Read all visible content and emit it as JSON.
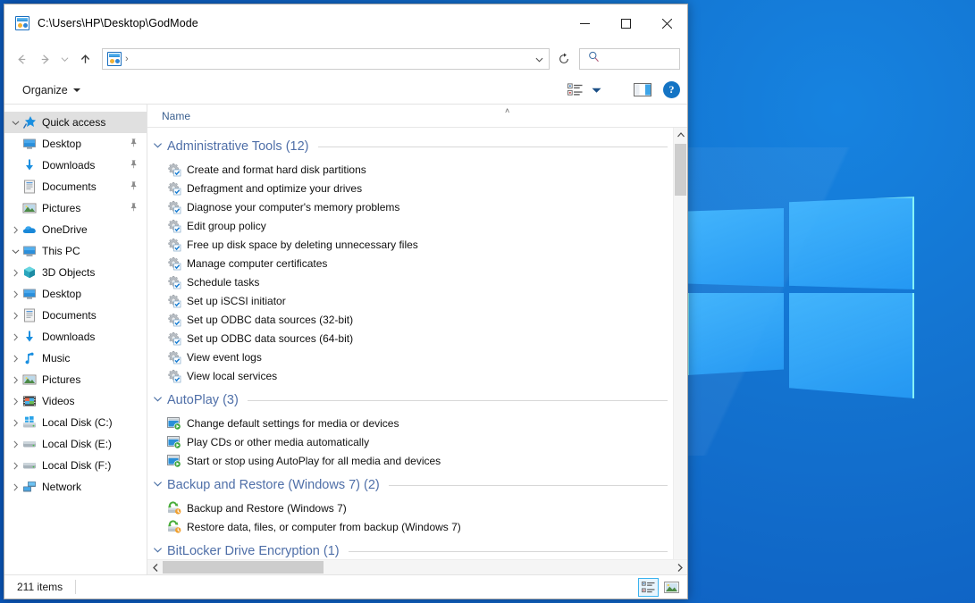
{
  "window": {
    "title": "C:\\Users\\HP\\Desktop\\GodMode",
    "title_icon": "godmode-folder-icon",
    "controls": {
      "minimize": "minimize-button",
      "maximize": "maximize-button",
      "close": "close-button"
    }
  },
  "nav": {
    "back": "back-button",
    "forward": "forward-button",
    "recent": "recent-locations-button",
    "up": "up-button",
    "refresh": "refresh-button",
    "address": {
      "icon": "godmode-folder-icon",
      "separator": "›",
      "dropdown": "previous-locations-icon"
    },
    "search": {
      "value": "",
      "placeholder": "",
      "icon": "search-icon"
    }
  },
  "toolbar": {
    "organize_label": "Organize",
    "view_options_icon": "view-options-icon",
    "view_options_dropdown": "chevron-down-icon",
    "preview_pane_icon": "preview-pane-icon",
    "help_label": "?"
  },
  "sidebar": {
    "items": [
      {
        "label": "Quick access",
        "icon": "pin-star-icon",
        "level": 0,
        "expander": "open",
        "selected": true,
        "pinned": false
      },
      {
        "label": "Desktop",
        "icon": "desktop-icon",
        "level": 1,
        "expander": "none",
        "selected": false,
        "pinned": true
      },
      {
        "label": "Downloads",
        "icon": "downloads-icon",
        "level": 1,
        "expander": "none",
        "selected": false,
        "pinned": true
      },
      {
        "label": "Documents",
        "icon": "documents-icon",
        "level": 1,
        "expander": "none",
        "selected": false,
        "pinned": true
      },
      {
        "label": "Pictures",
        "icon": "pictures-icon",
        "level": 1,
        "expander": "none",
        "selected": false,
        "pinned": true
      },
      {
        "label": "OneDrive",
        "icon": "onedrive-icon",
        "level": 0,
        "expander": "closed",
        "selected": false,
        "pinned": false
      },
      {
        "label": "This PC",
        "icon": "thispc-icon",
        "level": 0,
        "expander": "open",
        "selected": false,
        "pinned": false
      },
      {
        "label": "3D Objects",
        "icon": "3dobjects-icon",
        "level": 1,
        "expander": "closed",
        "selected": false,
        "pinned": false
      },
      {
        "label": "Desktop",
        "icon": "desktop-icon",
        "level": 1,
        "expander": "closed",
        "selected": false,
        "pinned": false
      },
      {
        "label": "Documents",
        "icon": "documents-icon",
        "level": 1,
        "expander": "closed",
        "selected": false,
        "pinned": false
      },
      {
        "label": "Downloads",
        "icon": "downloads-icon",
        "level": 1,
        "expander": "closed",
        "selected": false,
        "pinned": false
      },
      {
        "label": "Music",
        "icon": "music-icon",
        "level": 1,
        "expander": "closed",
        "selected": false,
        "pinned": false
      },
      {
        "label": "Pictures",
        "icon": "pictures-icon",
        "level": 1,
        "expander": "closed",
        "selected": false,
        "pinned": false
      },
      {
        "label": "Videos",
        "icon": "videos-icon",
        "level": 1,
        "expander": "closed",
        "selected": false,
        "pinned": false
      },
      {
        "label": "Local Disk (C:)",
        "icon": "windows-drive-icon",
        "level": 1,
        "expander": "closed",
        "selected": false,
        "pinned": false
      },
      {
        "label": "Local Disk (E:)",
        "icon": "drive-icon",
        "level": 1,
        "expander": "closed",
        "selected": false,
        "pinned": false
      },
      {
        "label": "Local Disk (F:)",
        "icon": "drive-icon",
        "level": 1,
        "expander": "closed",
        "selected": false,
        "pinned": false
      },
      {
        "label": "Network",
        "icon": "network-icon",
        "level": 0,
        "expander": "closed",
        "selected": false,
        "pinned": false
      }
    ]
  },
  "content": {
    "column_header": "Name",
    "sort_indicator": "˄",
    "groups": [
      {
        "title": "Administrative Tools (12)",
        "expanded": true,
        "icon_kind": "admin-tools-icon",
        "items": [
          "Create and format hard disk partitions",
          "Defragment and optimize your drives",
          "Diagnose your computer's memory problems",
          "Edit group policy",
          "Free up disk space by deleting unnecessary files",
          "Manage computer certificates",
          "Schedule tasks",
          "Set up iSCSI initiator",
          "Set up ODBC data sources (32-bit)",
          "Set up ODBC data sources (64-bit)",
          "View event logs",
          "View local services"
        ]
      },
      {
        "title": "AutoPlay (3)",
        "expanded": true,
        "icon_kind": "autoplay-icon",
        "items": [
          "Change default settings for media or devices",
          "Play CDs or other media automatically",
          "Start or stop using AutoPlay for all media and devices"
        ]
      },
      {
        "title": "Backup and Restore (Windows 7) (2)",
        "expanded": true,
        "icon_kind": "backup-restore-icon",
        "items": [
          "Backup and Restore (Windows 7)",
          "Restore data, files, or computer from backup (Windows 7)"
        ]
      },
      {
        "title": "BitLocker Drive Encryption (1)",
        "expanded": true,
        "icon_kind": "bitlocker-icon",
        "items": []
      }
    ]
  },
  "statusbar": {
    "item_count": "211 items",
    "details_view_icon": "details-view-icon",
    "large-icons_view_icon": "large-icons-view-icon",
    "active_view": "details"
  },
  "colors": {
    "accent": "#1474c4",
    "group_header": "#4f6fa8",
    "column_header": "#3a5f8f",
    "selection": "#e0e0e0",
    "desktop_blue": "#0f63c4"
  }
}
